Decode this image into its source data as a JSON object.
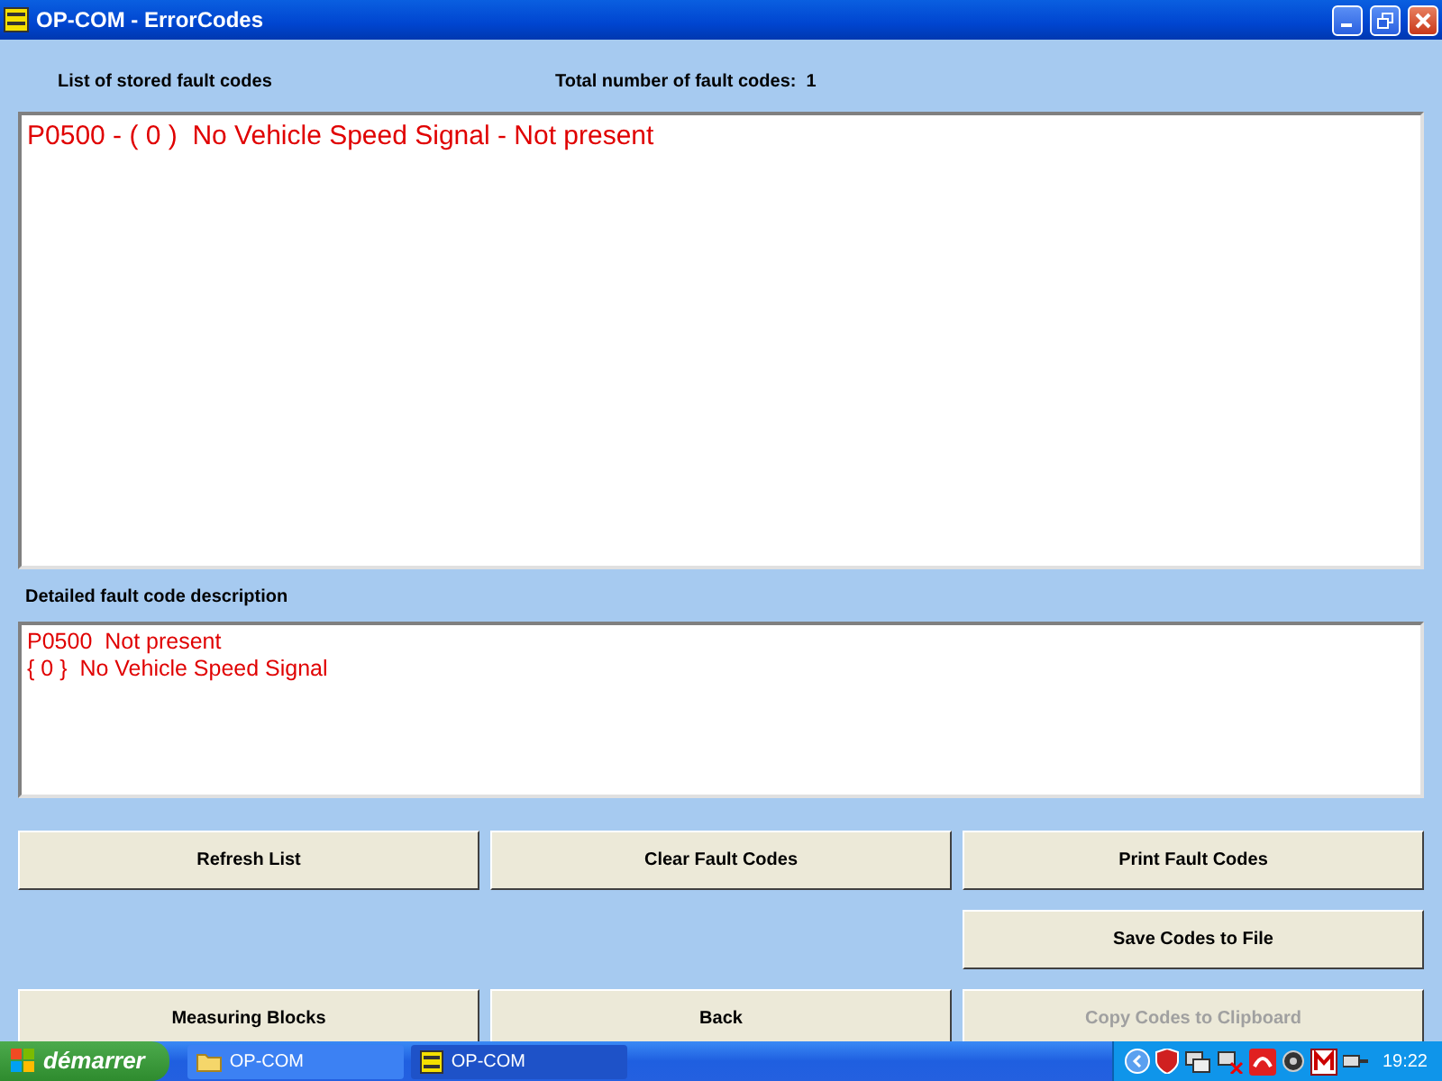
{
  "window": {
    "title": "OP-COM - ErrorCodes"
  },
  "fault_list": {
    "label": "List of stored fault codes",
    "total_label": "Total number of fault codes:",
    "total": "1",
    "items": [
      "P0500 - ( 0 )  No Vehicle Speed Signal - Not present"
    ]
  },
  "description": {
    "label": "Detailed fault code description",
    "lines": [
      "P0500  Not present",
      "{ 0 }  No Vehicle Speed Signal"
    ]
  },
  "button_rows": [
    {
      "kind": "full",
      "buttons": [
        {
          "label": "Refresh List",
          "disabled": false
        },
        {
          "label": "Clear Fault Codes",
          "disabled": false
        },
        {
          "label": "Print Fault Codes",
          "disabled": false
        }
      ]
    },
    {
      "kind": "end",
      "buttons": [
        {
          "label": "Save Codes to File",
          "disabled": false
        }
      ]
    },
    {
      "kind": "full",
      "buttons": [
        {
          "label": "Measuring Blocks",
          "disabled": false
        },
        {
          "label": "Back",
          "disabled": false
        },
        {
          "label": "Copy Codes to Clipboard",
          "disabled": true
        }
      ]
    }
  ],
  "taskbar": {
    "start": "démarrer",
    "tasks": [
      {
        "label": "OP-COM",
        "kind": "folder",
        "selected": false
      },
      {
        "label": "OP-COM",
        "kind": "app",
        "selected": true
      }
    ],
    "clock": "19:22"
  }
}
